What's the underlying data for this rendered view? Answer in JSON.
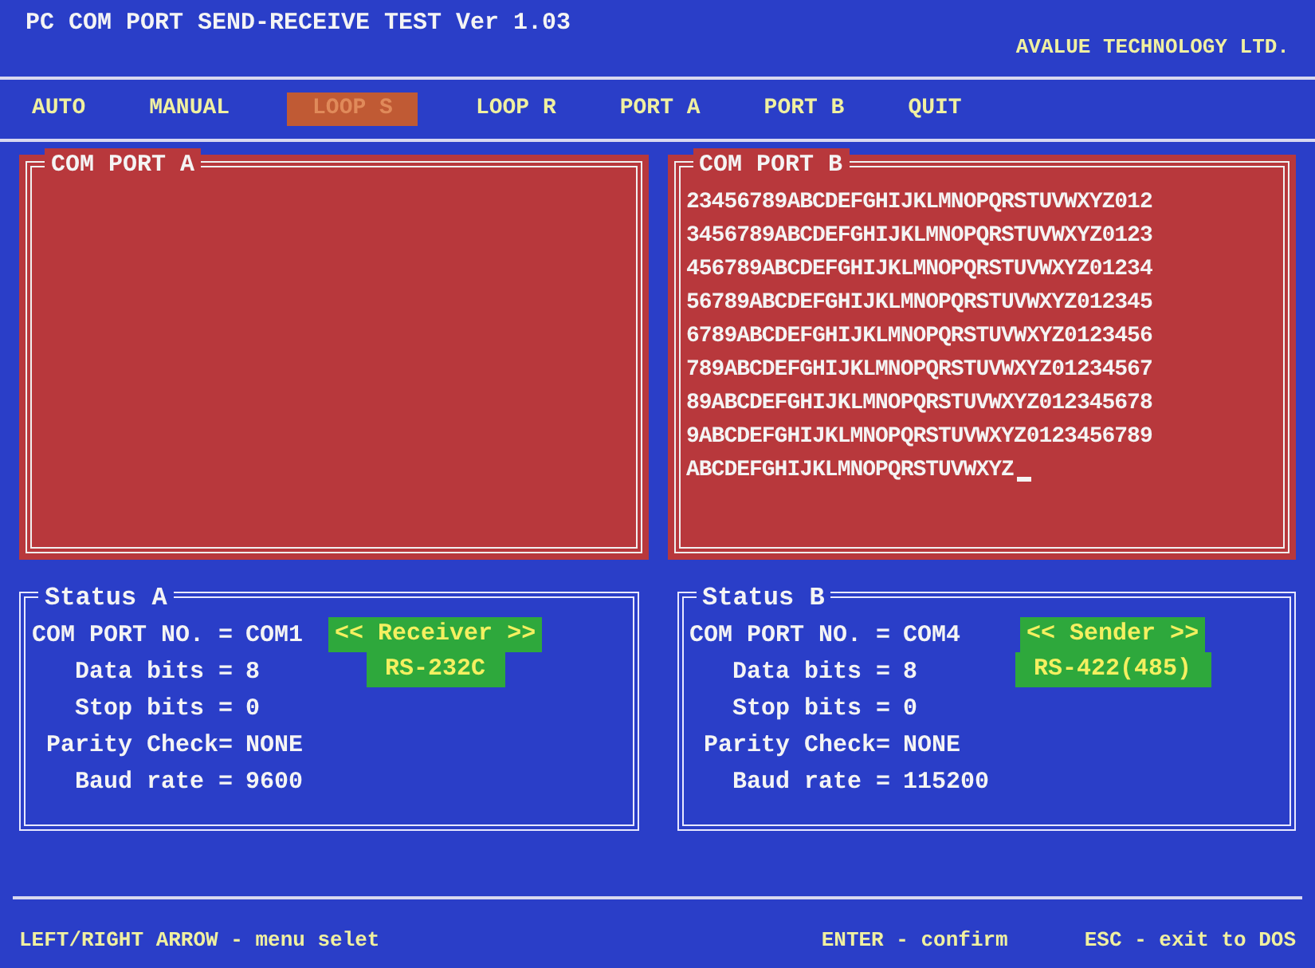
{
  "title": "PC COM PORT SEND-RECEIVE TEST Ver 1.03",
  "company": "AVALUE TECHNOLOGY LTD.",
  "menu": [
    {
      "label": "AUTO",
      "selected": false
    },
    {
      "label": "MANUAL",
      "selected": false
    },
    {
      "label": "LOOP S",
      "selected": true
    },
    {
      "label": "LOOP R",
      "selected": false
    },
    {
      "label": "PORT A",
      "selected": false
    },
    {
      "label": "PORT B",
      "selected": false
    },
    {
      "label": "QUIT",
      "selected": false
    }
  ],
  "ports": [
    {
      "title": "COM PORT A"
    },
    {
      "title": "COM PORT B",
      "lines": [
        "23456789ABCDEFGHIJKLMNOPQRSTUVWXYZ012",
        "3456789ABCDEFGHIJKLMNOPQRSTUVWXYZ0123",
        "456789ABCDEFGHIJKLMNOPQRSTUVWXYZ01234",
        "56789ABCDEFGHIJKLMNOPQRSTUVWXYZ012345",
        "6789ABCDEFGHIJKLMNOPQRSTUVWXYZ0123456",
        "789ABCDEFGHIJKLMNOPQRSTUVWXYZ01234567",
        "89ABCDEFGHIJKLMNOPQRSTUVWXYZ012345678",
        "9ABCDEFGHIJKLMNOPQRSTUVWXYZ0123456789",
        "ABCDEFGHIJKLMNOPQRSTUVWXYZ"
      ]
    }
  ],
  "status": [
    {
      "title": "Status A",
      "rows": [
        {
          "label": "COM PORT NO. =",
          "value": "COM1"
        },
        {
          "label": "Data bits =",
          "value": "8"
        },
        {
          "label": "Stop bits =",
          "value": "0"
        },
        {
          "label": "Parity Check=",
          "value": "NONE"
        },
        {
          "label": "Baud rate =",
          "value": "9600"
        }
      ],
      "role": "<< Receiver >>",
      "interface": "RS-232C"
    },
    {
      "title": "Status B",
      "rows": [
        {
          "label": "COM PORT NO. =",
          "value": "COM4"
        },
        {
          "label": "Data bits =",
          "value": "8"
        },
        {
          "label": "Stop bits =",
          "value": "0"
        },
        {
          "label": "Parity Check=",
          "value": "NONE"
        },
        {
          "label": "Baud rate =",
          "value": "115200"
        }
      ],
      "role": "<< Sender >>",
      "interface": "RS-422(485)"
    }
  ],
  "footer": [
    "LEFT/RIGHT ARROW - menu selet",
    "ENTER - confirm",
    "ESC - exit to DOS"
  ]
}
